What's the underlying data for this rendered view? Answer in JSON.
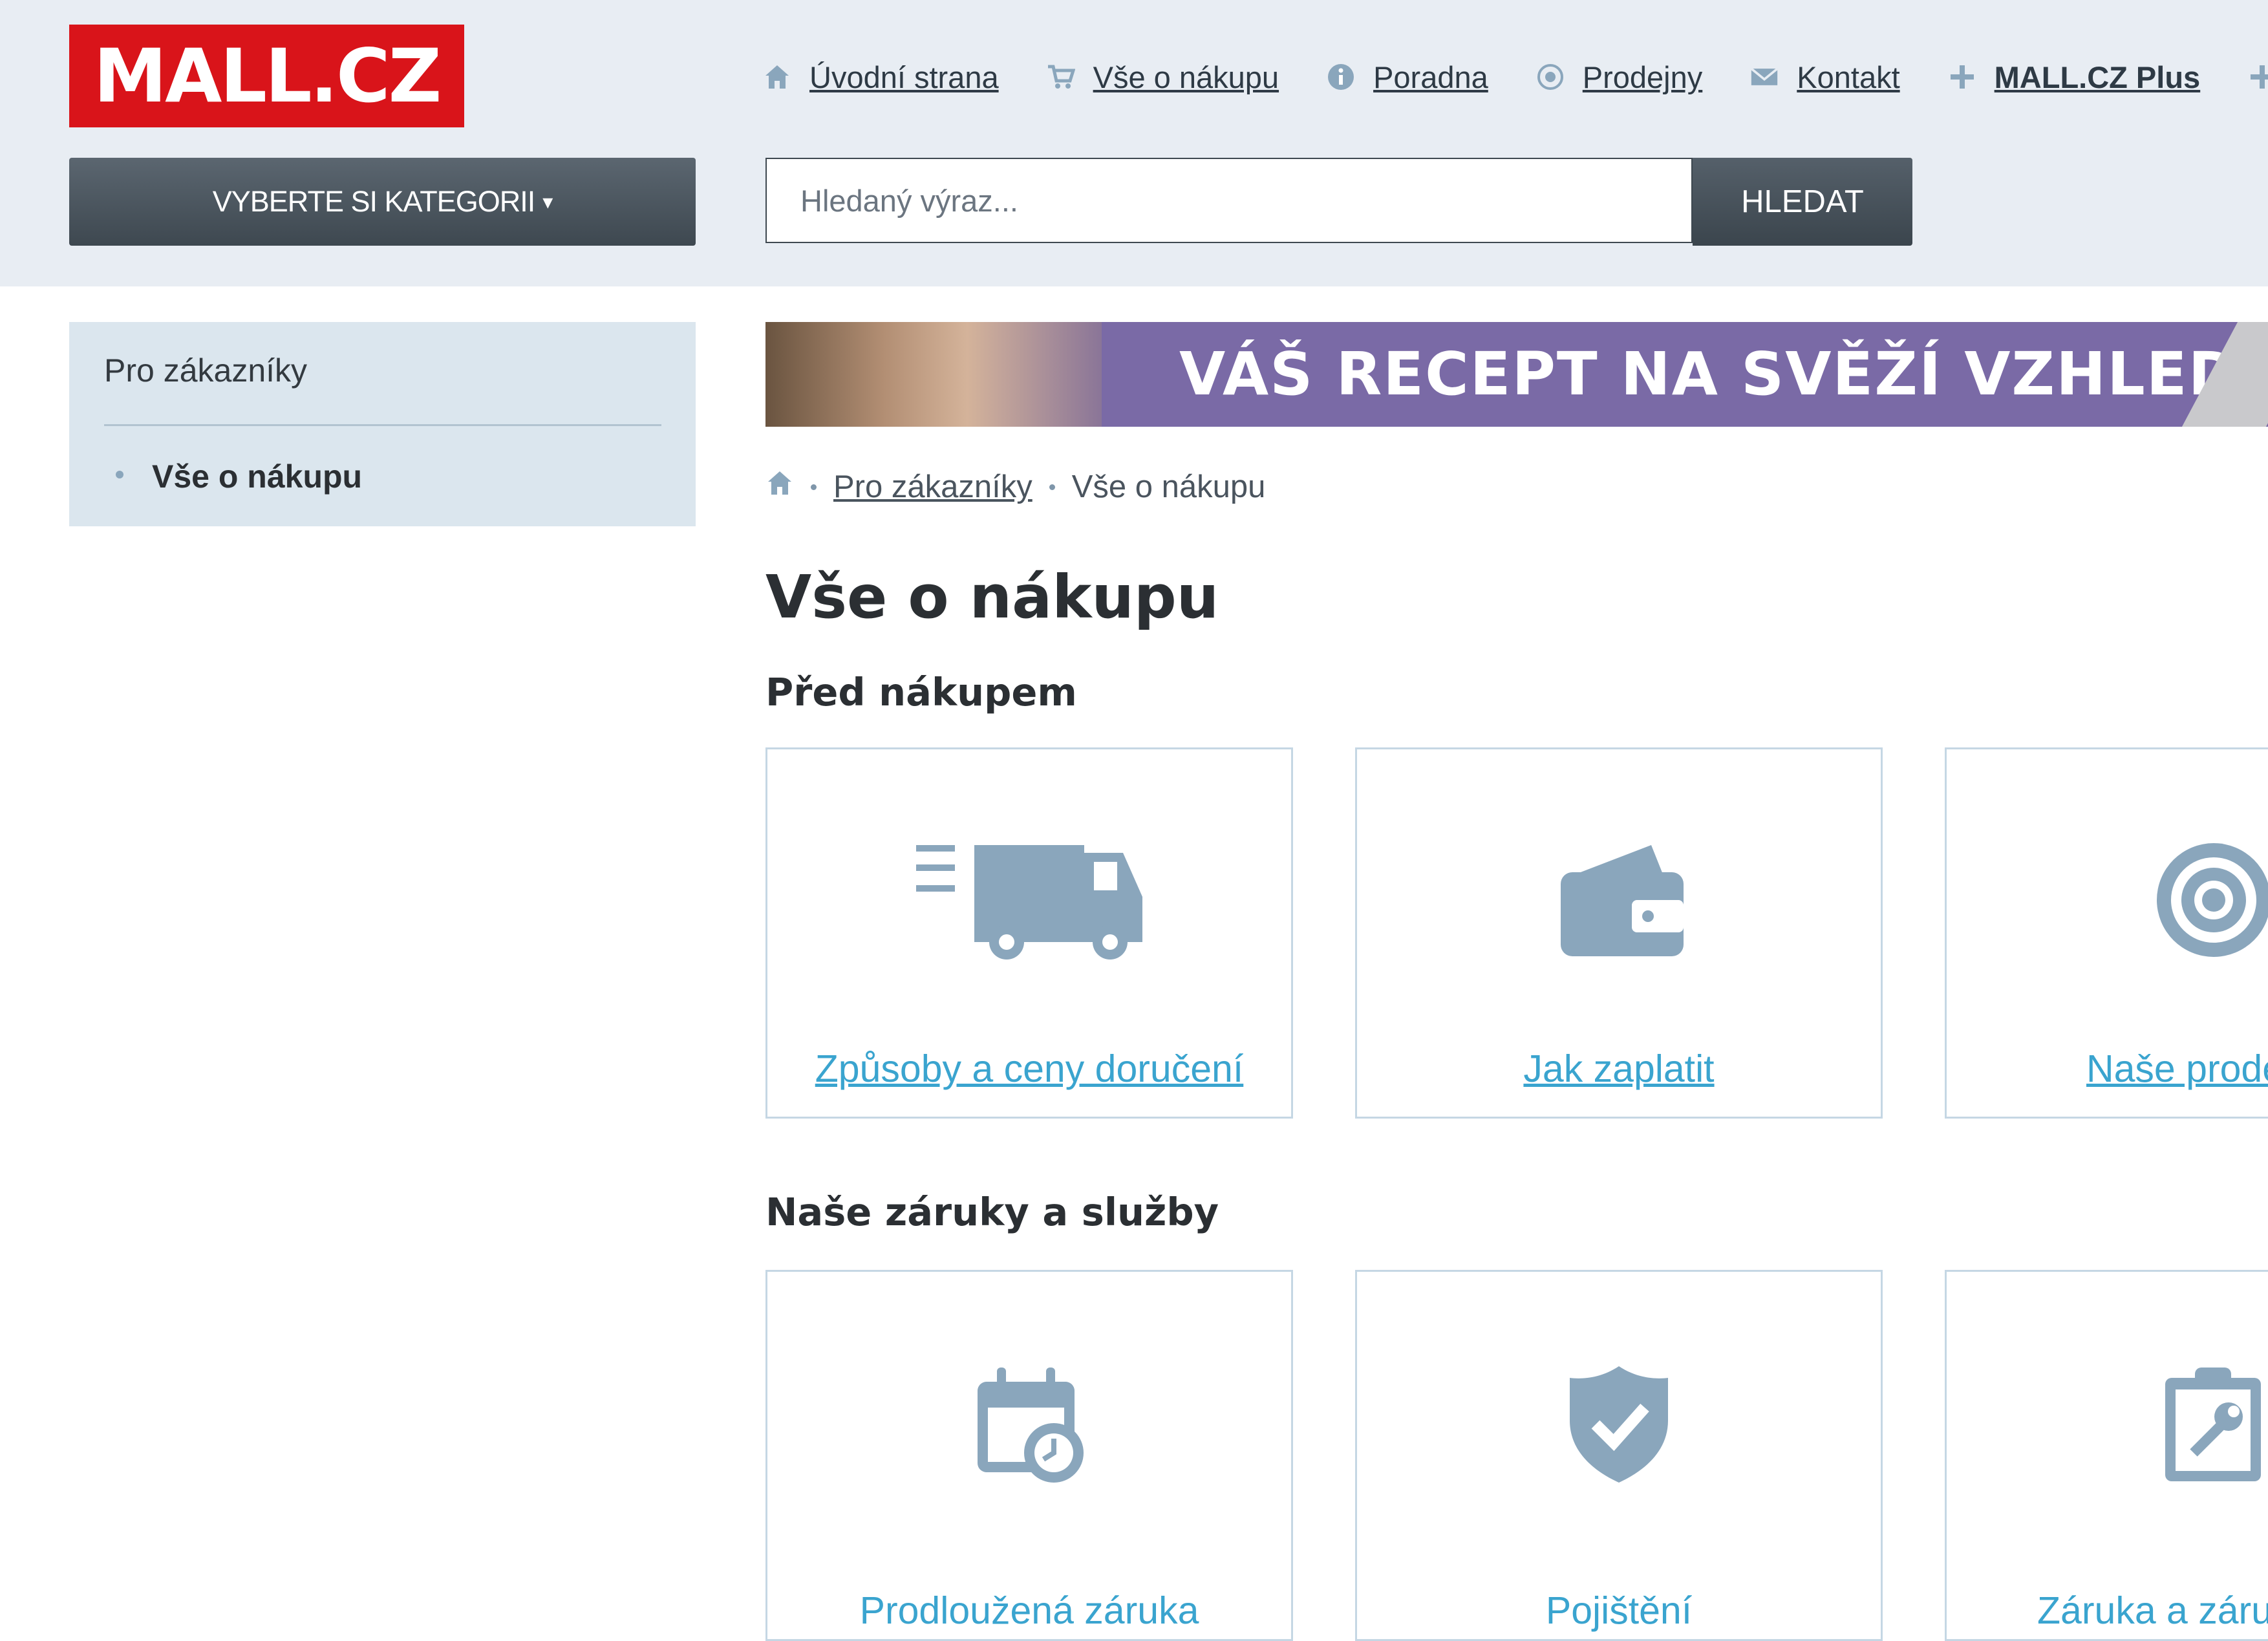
{
  "brand": {
    "logo_text": "MALL.CZ",
    "accent": "#d9141a"
  },
  "topnav": [
    {
      "label": "Úvodní strana",
      "icon": "home-icon"
    },
    {
      "label": "Vše o nákupu",
      "icon": "cart-icon"
    },
    {
      "label": "Poradna",
      "icon": "info-icon"
    },
    {
      "label": "Prodejny",
      "icon": "location-icon"
    },
    {
      "label": "Kontakt",
      "icon": "envelope-icon"
    },
    {
      "label": "MALL.CZ Plus",
      "icon": "plus-icon"
    }
  ],
  "category_button": {
    "label": "VYBERTE SI KATEGORII",
    "caret": "▾"
  },
  "search": {
    "placeholder": "Hledaný výraz...",
    "button_label": "HLEDAT"
  },
  "sidebar": {
    "title": "Pro zákazníky",
    "items": [
      {
        "label": "Vše o nákupu"
      }
    ]
  },
  "banner": {
    "text": "VÁŠ RECEPT NA SVĚŽÍ VZHLED"
  },
  "breadcrumb": {
    "home_icon": "home-icon",
    "items": [
      "Pro zákazníky",
      "Vše o nákupu"
    ]
  },
  "page": {
    "title": "Vše o nákupu",
    "sections": [
      {
        "heading": "Před nákupem",
        "cards": [
          {
            "label": "Způsoby a ceny doručení",
            "icon": "truck-icon"
          },
          {
            "label": "Jak zaplatit",
            "icon": "wallet-icon"
          },
          {
            "label": "Naše prode",
            "icon": "target-icon"
          }
        ]
      },
      {
        "heading": "Naše záruky a služby",
        "cards": [
          {
            "label": "Prodloužená záruka",
            "icon": "calendar-clock-icon"
          },
          {
            "label": "Pojištění",
            "icon": "shield-check-icon"
          },
          {
            "label": "Záruka a záru",
            "icon": "clipboard-wrench-icon"
          }
        ]
      }
    ]
  }
}
